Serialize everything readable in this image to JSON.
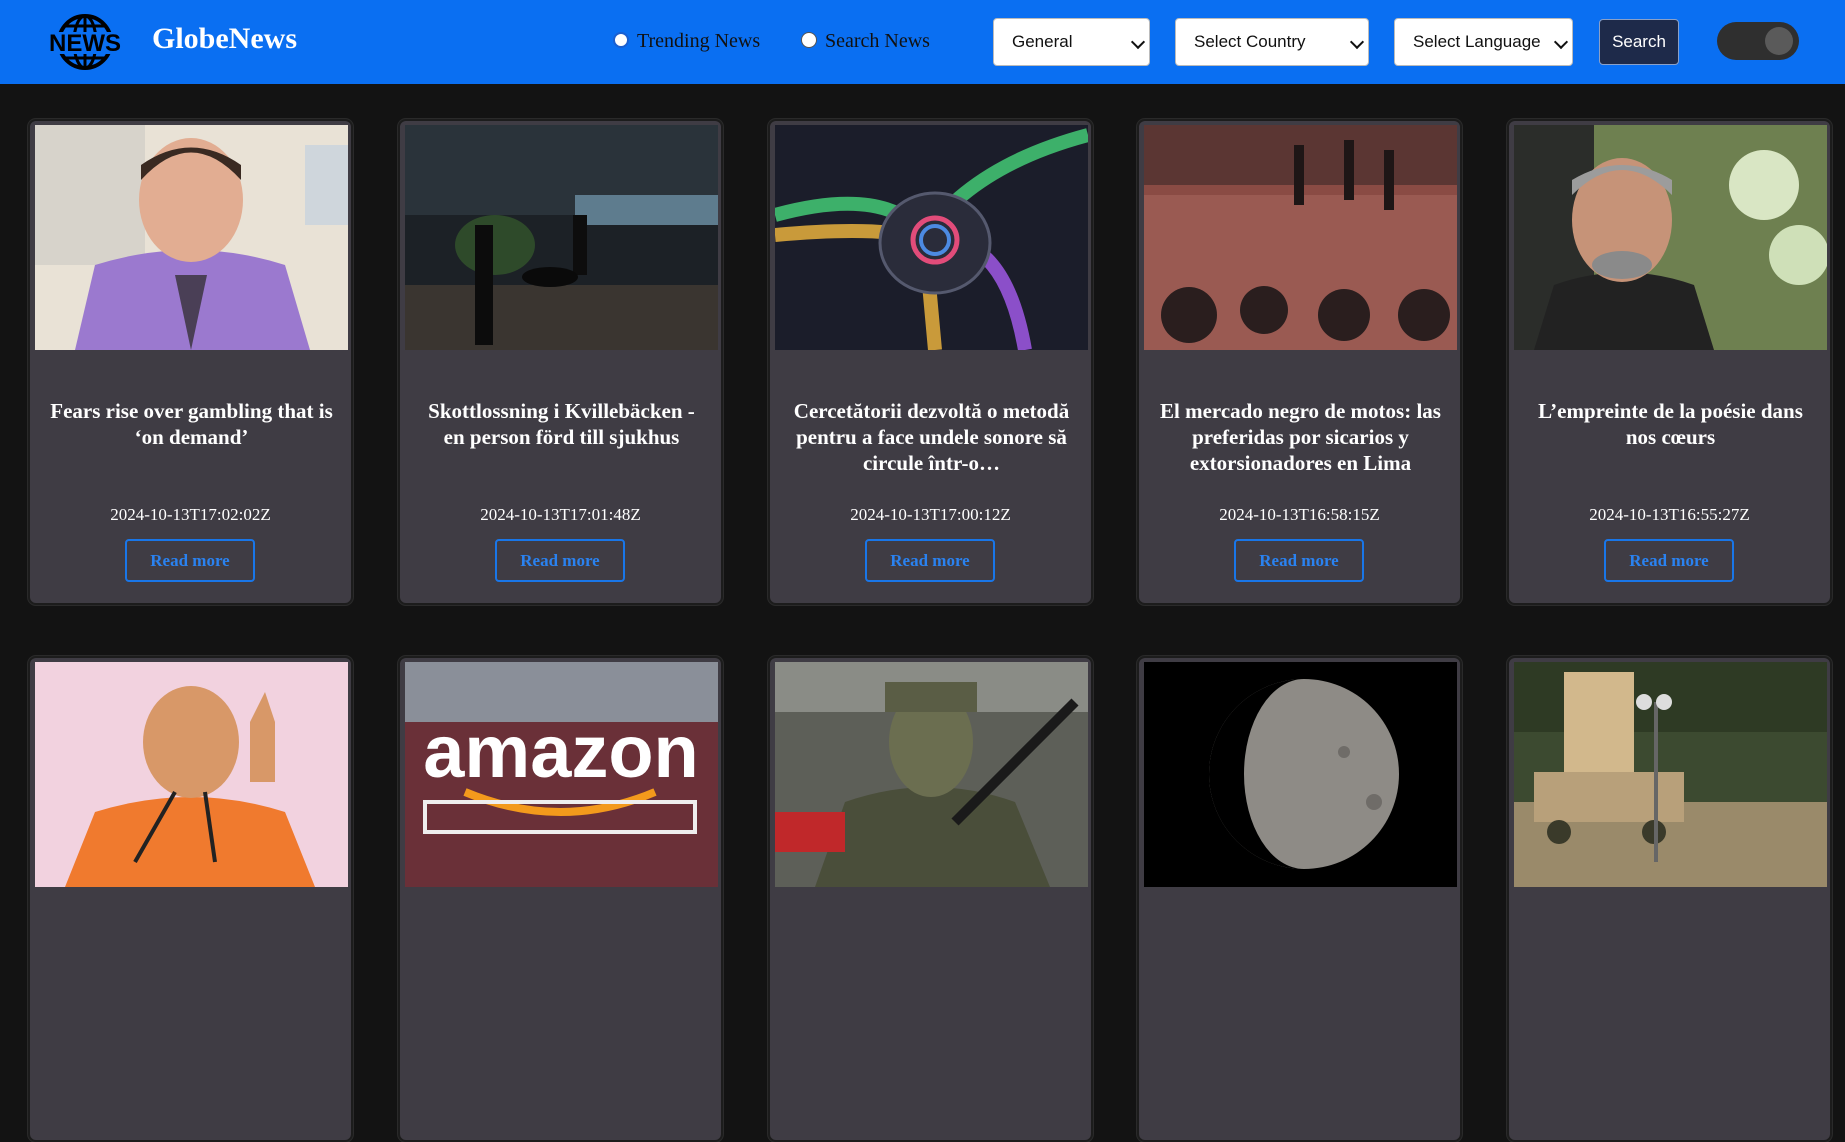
{
  "nav": {
    "logo_text": "NEWS",
    "brand": "GlobeNews",
    "radio_trending": "Trending News",
    "radio_search": "Search News",
    "category_select": "General",
    "country_select": "Select Country",
    "language_select": "Select Language",
    "search_button": "Search"
  },
  "colors": {
    "navbar": "#0a6ff2",
    "background": "#131313",
    "card": "#3f3c44",
    "accent": "#1976e8"
  },
  "articles": [
    {
      "title": "Fears rise over gambling that is ‘on demand’",
      "date": "2024-10-13T17:02:02Z",
      "cta": "Read more"
    },
    {
      "title": "Skottlossning i Kvillebäcken - en person förd till sjukhus",
      "date": "2024-10-13T17:01:48Z",
      "cta": "Read more"
    },
    {
      "title": "Cercetătorii dezvoltă o metodă pentru a face undele sonore să circule într-o…",
      "date": "2024-10-13T17:00:12Z",
      "cta": "Read more"
    },
    {
      "title": "El mercado negro de motos: las preferidas por sicarios y extorsionadores en Lima",
      "date": "2024-10-13T16:58:15Z",
      "cta": "Read more"
    },
    {
      "title": "L’empreinte de la poésie dans nos cœurs",
      "date": "2024-10-13T16:55:27Z",
      "cta": "Read more"
    },
    {
      "title": "",
      "date": "",
      "cta": ""
    },
    {
      "title": "",
      "date": "",
      "cta": ""
    },
    {
      "title": "",
      "date": "",
      "cta": ""
    },
    {
      "title": "",
      "date": "",
      "cta": ""
    },
    {
      "title": "",
      "date": "",
      "cta": ""
    }
  ]
}
